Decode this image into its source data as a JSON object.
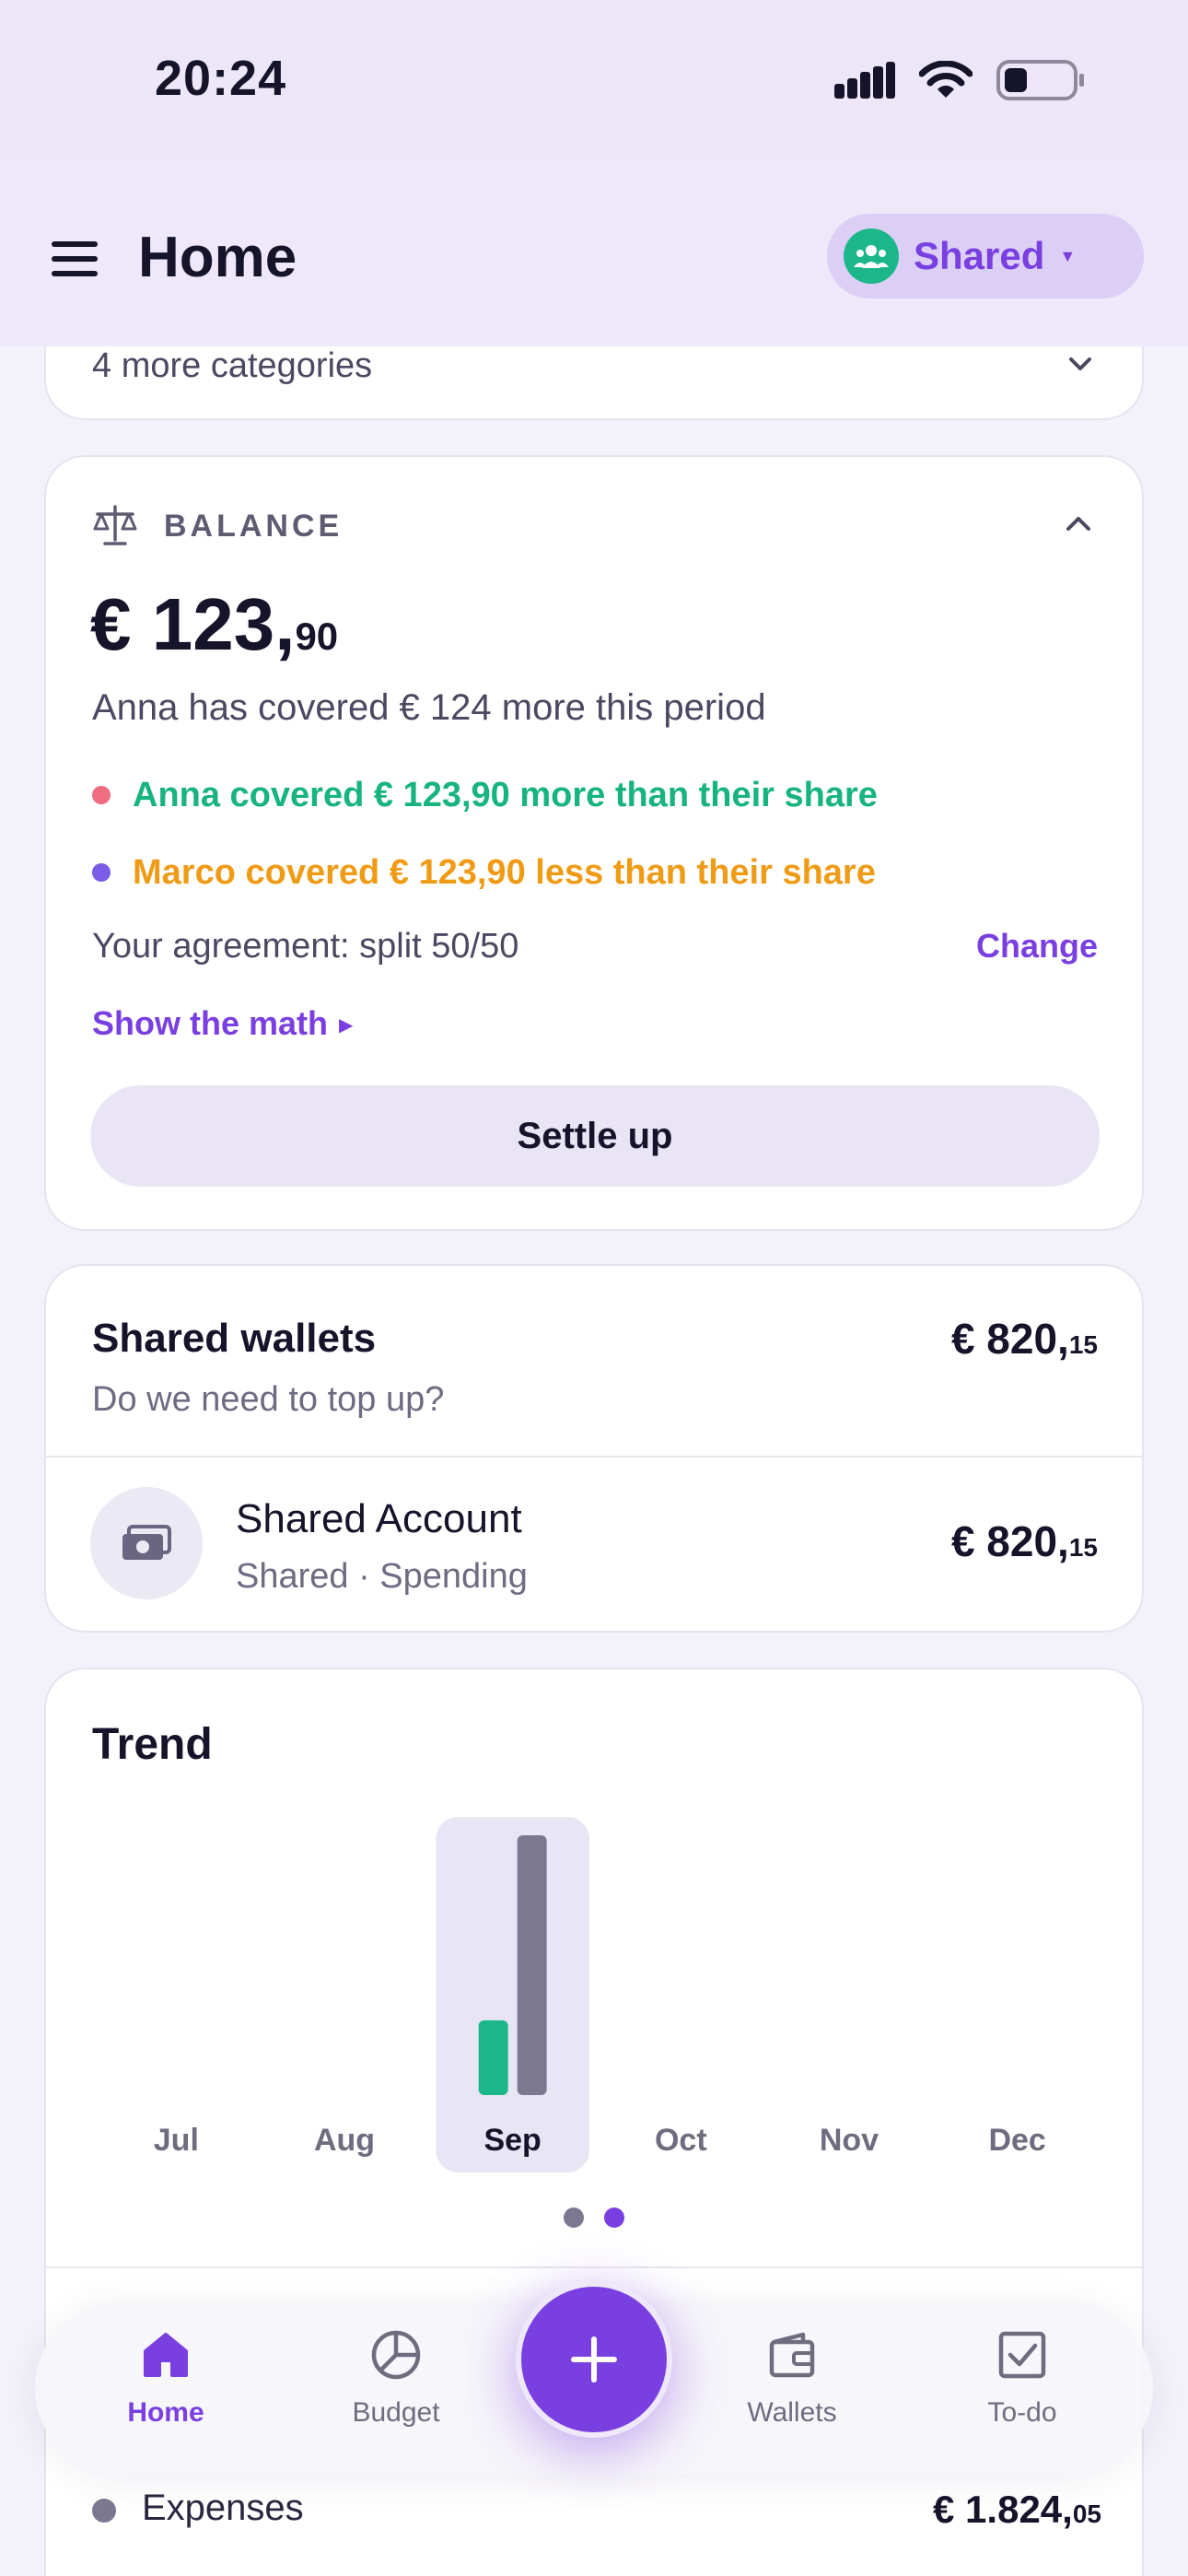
{
  "status_bar": {
    "time": "20:24"
  },
  "header": {
    "title": "Home",
    "space_selector": "Shared"
  },
  "categories_footer": {
    "more_label": "4 more categories"
  },
  "balance": {
    "section_label": "BALANCE",
    "currency": "€",
    "amount_main": "123,",
    "amount_cents": "90",
    "summary": "Anna has covered € 124 more this period",
    "lines": [
      {
        "text": "Anna covered € 123,90 more than their share",
        "color": "#17b380"
      },
      {
        "text": "Marco covered € 123,90 less than their share",
        "color": "#f09b16"
      }
    ],
    "agreement": "Your agreement: split 50/50",
    "change_label": "Change",
    "math_label": "Show the math",
    "settle_label": "Settle up"
  },
  "shared_wallets": {
    "title": "Shared wallets",
    "subtitle": "Do we need to top up?",
    "total_main": "€ 820,",
    "total_cents": "15",
    "accounts": [
      {
        "name": "Shared Account",
        "meta": "Shared · Spending",
        "amount_main": "€ 820,",
        "amount_cents": "15"
      }
    ]
  },
  "trend": {
    "title": "Trend",
    "selected_month": "Sep",
    "page_indicator": {
      "pages": 2,
      "current": 2
    },
    "expenses_row": {
      "label": "Expenses",
      "amount_main": "€ 1.824,",
      "amount_cents": "05"
    }
  },
  "chart_data": {
    "type": "bar",
    "categories": [
      "Jul",
      "Aug",
      "Sep",
      "Oct",
      "Nov",
      "Dec"
    ],
    "series": [
      {
        "values": [
          0,
          0,
          525,
          0,
          0,
          0
        ],
        "color": "#1bb78a"
      },
      {
        "values": [
          0,
          0,
          1824.05,
          0,
          0,
          0
        ],
        "color": "#7d7892"
      }
    ],
    "ylim": [
      0,
      1824.05
    ],
    "grid": false
  },
  "nav": {
    "tabs": [
      {
        "label": "Home",
        "icon": "home-icon",
        "active": true
      },
      {
        "label": "Budget",
        "icon": "pie-chart-icon",
        "active": false
      },
      {
        "label": "Wallets",
        "icon": "wallet-icon",
        "active": false
      },
      {
        "label": "To-do",
        "icon": "checkbox-icon",
        "active": false
      }
    ],
    "fab_icon": "plus-icon"
  },
  "colors": {
    "accent": "#7a3fe0",
    "positive": "#17b380",
    "warning": "#f09b16",
    "neutral_bar": "#7d7892"
  }
}
